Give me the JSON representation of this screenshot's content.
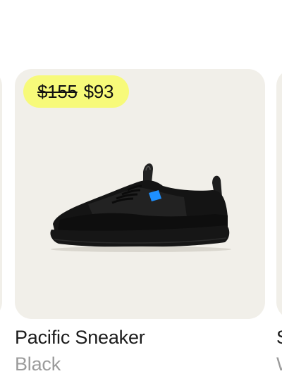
{
  "products": [
    {
      "name": "",
      "color": ""
    },
    {
      "name": "Pacific Sneaker",
      "color": "Black",
      "price_original": "$155",
      "price_sale": "$93",
      "image_icon": "black-sneaker-image"
    },
    {
      "name": "S",
      "color": "W"
    }
  ],
  "colors": {
    "card_background": "#f1efe9",
    "badge_background": "#f7fa7a",
    "name_text": "#1b1b1b",
    "color_text": "#9b9b9b",
    "shoe_accent": "#1e90ff"
  }
}
